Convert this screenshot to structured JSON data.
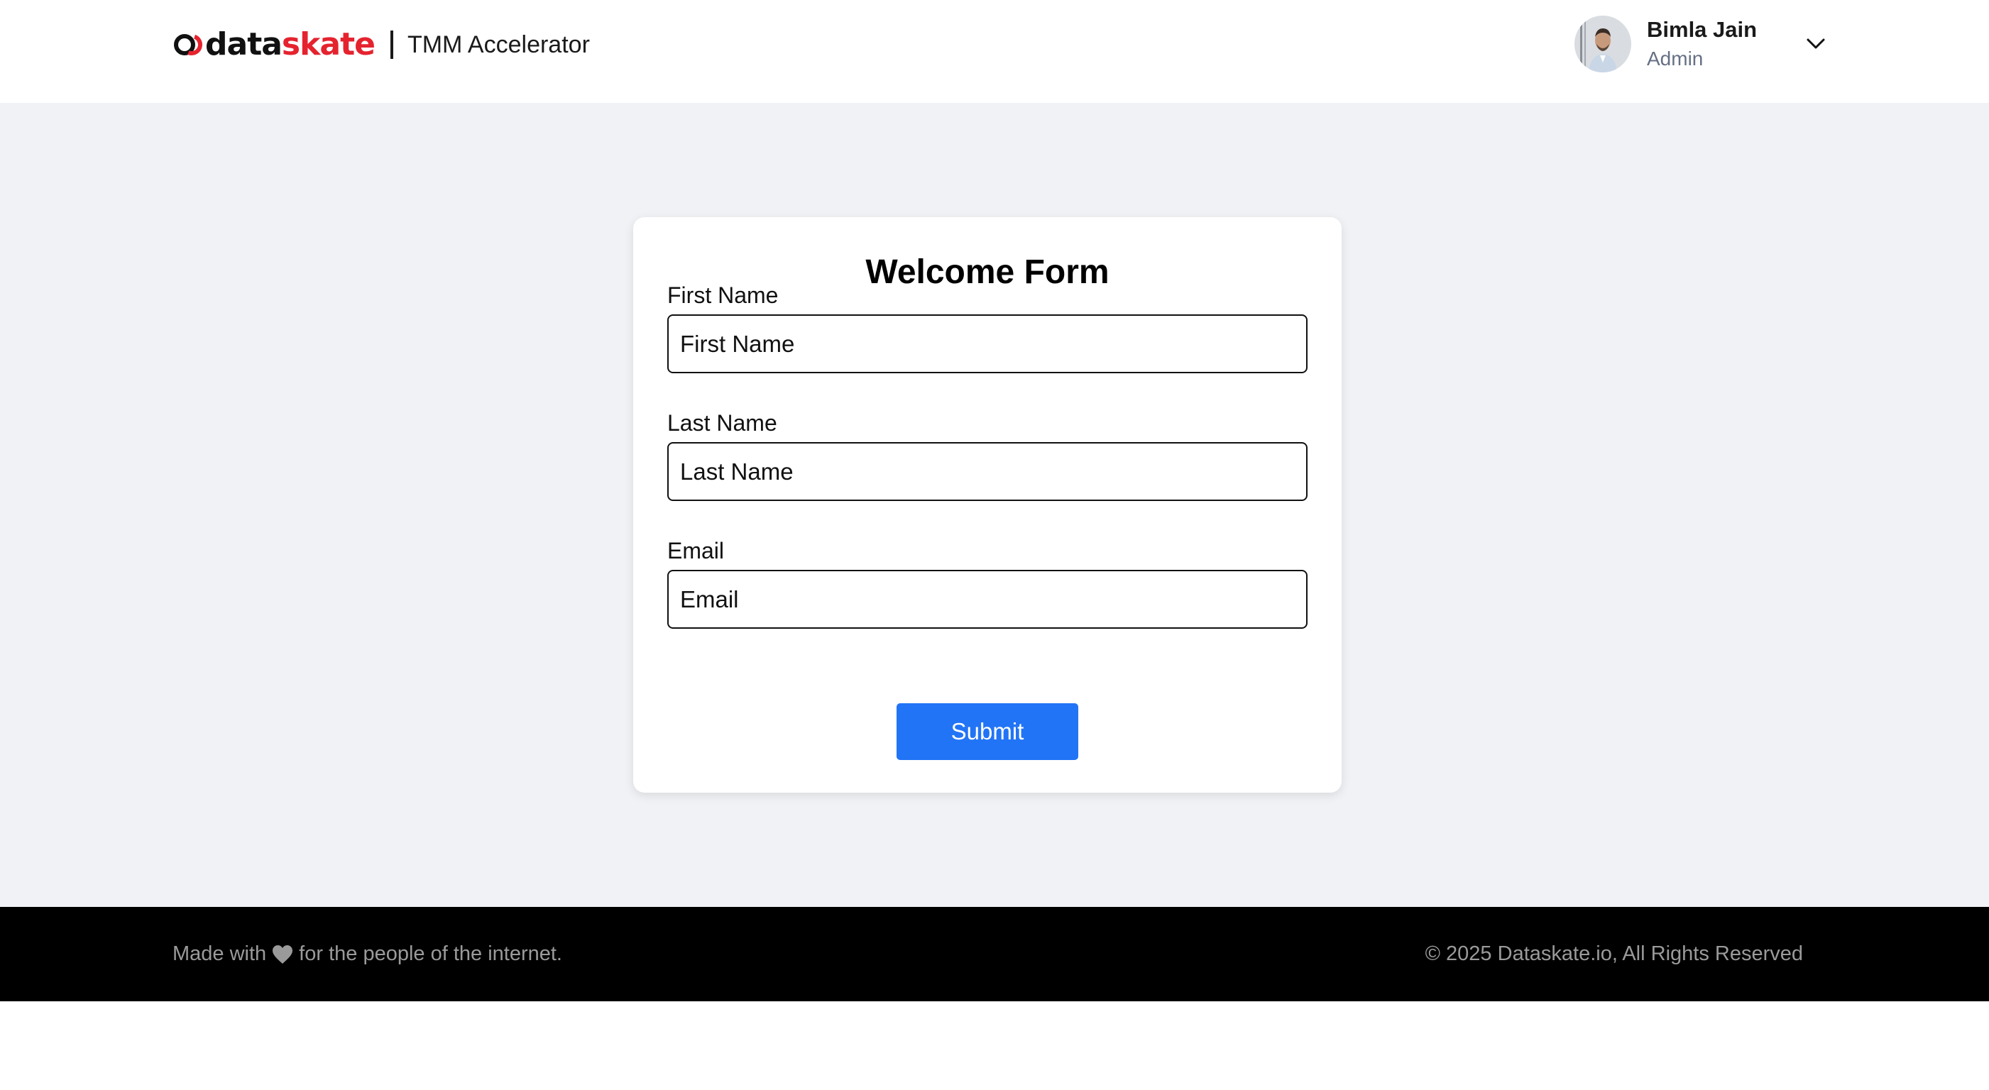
{
  "header": {
    "logo": {
      "brand_part1": "data",
      "brand_part2": "skate",
      "product": "TMM Accelerator"
    },
    "user": {
      "name": "Bimla Jain",
      "role": "Admin",
      "avatar_icon": "avatar-photo",
      "menu_icon": "chevron-down-icon"
    }
  },
  "form": {
    "title": "Welcome Form",
    "fields": [
      {
        "label": "First Name",
        "placeholder": "First Name",
        "value": ""
      },
      {
        "label": "Last Name",
        "placeholder": "Last Name",
        "value": ""
      },
      {
        "label": "Email",
        "placeholder": "Email",
        "value": ""
      }
    ],
    "submit_label": "Submit"
  },
  "footer": {
    "made_with_prefix": "Made with",
    "made_with_suffix": "for the people of the internet.",
    "heart_icon": "heart-icon",
    "copyright": "© 2025 Dataskate.io, All Rights Reserved"
  },
  "colors": {
    "brand_red": "#e5232f",
    "primary_button": "#2274f6",
    "page_background": "#f0f2f5",
    "footer_background": "#000000"
  }
}
